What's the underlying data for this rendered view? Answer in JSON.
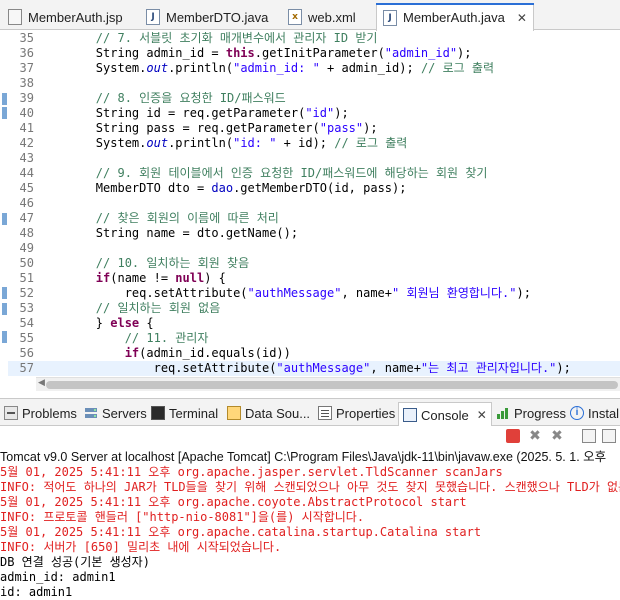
{
  "editor_tabs": [
    {
      "icon": "jsp-file-icon",
      "glyph": "",
      "label": "MemberAuth.jsp"
    },
    {
      "icon": "java-file-icon",
      "glyph": "J",
      "label": "MemberDTO.java"
    },
    {
      "icon": "xml-file-icon",
      "glyph": "x",
      "label": "web.xml"
    },
    {
      "icon": "java-file-icon",
      "glyph": "J",
      "label": "MemberAuth.java",
      "active": true,
      "close": "✕"
    }
  ],
  "code": {
    "line_numbers": [
      "35",
      "36",
      "37",
      "38",
      "39",
      "40",
      "41",
      "42",
      "43",
      "44",
      "45",
      "46",
      "47",
      "48",
      "49",
      "50",
      "51",
      "52",
      "53",
      "54",
      "55",
      "56",
      "57"
    ],
    "current_line": "57"
  },
  "panel_tabs": [
    {
      "icon": "problems-icon",
      "label": "Problems"
    },
    {
      "icon": "servers-icon",
      "label": "Servers"
    },
    {
      "icon": "terminal-icon",
      "label": "Terminal"
    },
    {
      "icon": "data-source-icon",
      "label": "Data Sou..."
    },
    {
      "icon": "properties-icon",
      "label": "Properties"
    },
    {
      "icon": "console-icon",
      "label": "Console",
      "active": true,
      "close": "✕"
    },
    {
      "icon": "progress-icon",
      "label": "Progress"
    },
    {
      "icon": "install-icon",
      "label": "Install"
    }
  ],
  "console": {
    "title": "Tomcat v9.0 Server at localhost [Apache Tomcat] C:\\Program Files\\Java\\jdk-11\\bin\\javaw.exe  (2025. 5. 1. 오후",
    "lines": [
      {
        "type": "err",
        "text": "5월 01, 2025 5:41:11 오후 org.apache.jasper.servlet.TldScanner scanJars"
      },
      {
        "type": "err",
        "text": "INFO: 적어도 하나의 JAR가 TLD들을 찾기 위해 스캔되었으나 아무 것도 찾지 못했습니다. 스캔했으나 TLD가 없는 JAR들"
      },
      {
        "type": "err",
        "text": "5월 01, 2025 5:41:11 오후 org.apache.coyote.AbstractProtocol start"
      },
      {
        "type": "err",
        "text": "INFO: 프로토콜 핸들러 [\"http-nio-8081\"]을(를) 시작합니다."
      },
      {
        "type": "err",
        "text": "5월 01, 2025 5:41:11 오후 org.apache.catalina.startup.Catalina start"
      },
      {
        "type": "err",
        "text": "INFO: 서버가 [650] 밀리초 내에 시작되었습니다."
      },
      {
        "type": "std",
        "text": "DB 연결 성공(기본 생성자)"
      },
      {
        "type": "std",
        "text": "admin_id: admin1"
      },
      {
        "type": "std",
        "text": "id: admin1"
      }
    ]
  },
  "colors": {
    "comment": "#3f7f5f",
    "keyword": "#7f0055",
    "string": "#2a00ff",
    "stderr": "#e02020",
    "current_line": "#e8f2fe",
    "active_tab_accent": "#2b6fd6"
  }
}
